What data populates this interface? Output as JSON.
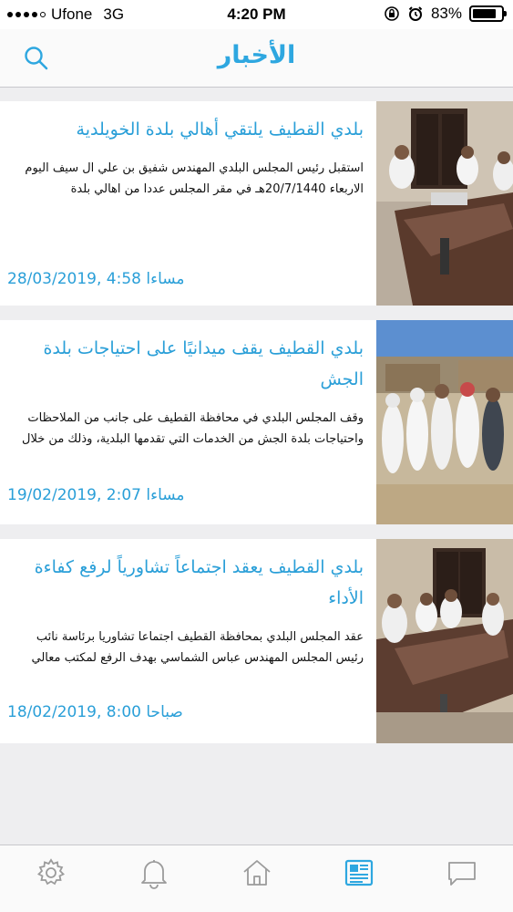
{
  "status_bar": {
    "carrier": "Ufone",
    "network": "3G",
    "time": "4:20 PM",
    "battery_percent": "83%",
    "battery_level": 0.83
  },
  "nav": {
    "title": "الأخبار",
    "search_icon": "search-icon"
  },
  "news": [
    {
      "title": "بلدي القطيف يلتقي أهالي بلدة الخويلدية",
      "summary": "استقبل رئيس المجلس البلدي المهندس شفيق بن علي ال سيف اليوم الاربعاء 20/7/1440هـ في مقر المجلس عددا من اهالي بلدة",
      "date": "28/03/2019, 4:58 مساءا",
      "image": "meeting-photo"
    },
    {
      "title": "بلدي القطيف يقف ميدانيًا على احتياجات بلدة الجش",
      "summary": "وقف المجلس البلدي في محافظة القطيف على جانب من الملاحظات واحتياجات بلدة الجش من الخدمات التي تقدمها البلدية، وذلك من خلال",
      "date": "19/02/2019, 2:07 مساءا",
      "image": "field-visit-photo"
    },
    {
      "title": "بلدي القطيف يعقد اجتماعاً تشاورياً لرفع كفاءة الأداء",
      "summary": "عقد المجلس البلدي بمحافظة القطيف اجتماعا تشاوريا برئاسة نائب رئيس المجلس المهندس عباس الشماسي بهدف الرفع لمكتب معالي",
      "date": "18/02/2019, 8:00 صباحا",
      "image": "meeting-photo"
    }
  ],
  "tab_bar": {
    "tabs": [
      {
        "icon": "gear-icon",
        "active": false
      },
      {
        "icon": "bell-icon",
        "active": false
      },
      {
        "icon": "home-icon",
        "active": false
      },
      {
        "icon": "news-icon",
        "active": true
      },
      {
        "icon": "chat-icon",
        "active": false
      }
    ],
    "active_color": "#2ea7e0",
    "inactive_color": "#9b9b9b"
  },
  "colors": {
    "accent": "#2ea7e0",
    "background": "#eeeef0"
  }
}
